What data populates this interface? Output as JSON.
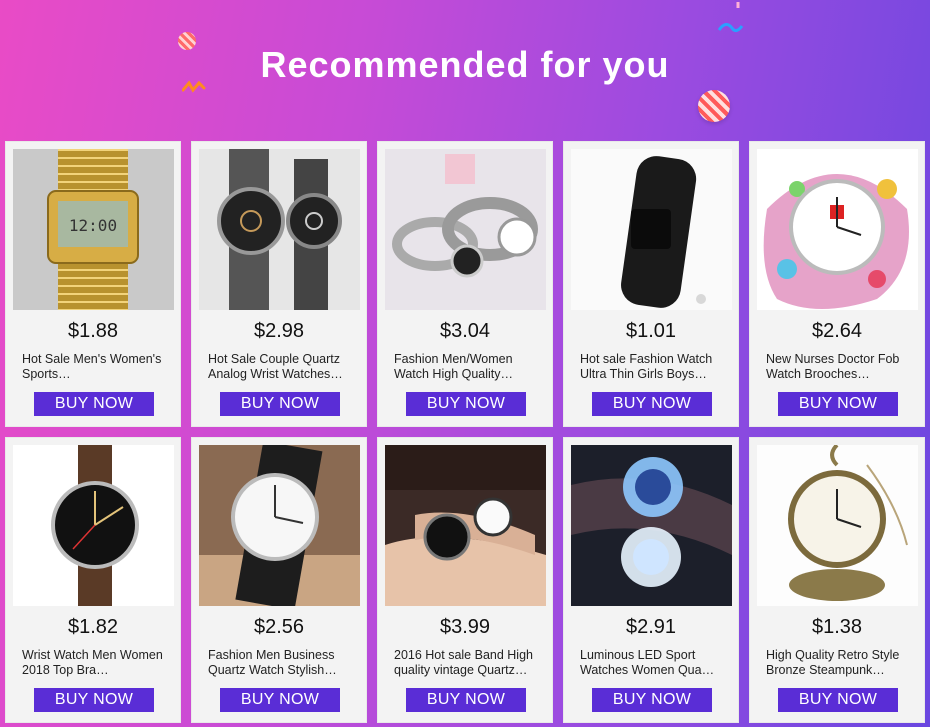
{
  "header": {
    "title": "Recommended for you"
  },
  "colors": {
    "button": "#5a2dd6",
    "card_bg": "#f3f3f3"
  },
  "products": [
    {
      "price": "$1.88",
      "name": "Hot Sale Men's Women's Sports…",
      "button": "BUY NOW",
      "image": "gold-digital-watch"
    },
    {
      "price": "$2.98",
      "name": "Hot Sale Couple Quartz Analog Wrist Watches…",
      "button": "BUY NOW",
      "image": "couple-steel-watches"
    },
    {
      "price": "$3.04",
      "name": "Fashion Men/Women Watch High Quality…",
      "button": "BUY NOW",
      "image": "elastic-band-watches"
    },
    {
      "price": "$1.01",
      "name": "Hot sale Fashion Watch Ultra Thin Girls Boys…",
      "button": "BUY NOW",
      "image": "black-led-watch"
    },
    {
      "price": "$2.64",
      "name": "New Nurses Doctor Fob Watch Brooches…",
      "button": "BUY NOW",
      "image": "nurse-fob-watch"
    },
    {
      "price": "$1.82",
      "name": "Wrist Watch Men Women 2018 Top Bra…",
      "button": "BUY NOW",
      "image": "brown-leather-watch"
    },
    {
      "price": "$2.56",
      "name": "Fashion Men Business Quartz Watch Stylish…",
      "button": "BUY NOW",
      "image": "white-dial-business-watch"
    },
    {
      "price": "$3.99",
      "name": "2016 Hot sale Band High quality vintage Quartz…",
      "button": "BUY NOW",
      "image": "couple-wrist-photo"
    },
    {
      "price": "$2.91",
      "name": "Luminous LED Sport Watches Women Qua…",
      "button": "BUY NOW",
      "image": "luminous-led-watches"
    },
    {
      "price": "$1.38",
      "name": "High Quality Retro Style Bronze Steampunk…",
      "button": "BUY NOW",
      "image": "bronze-pocket-watch"
    }
  ]
}
